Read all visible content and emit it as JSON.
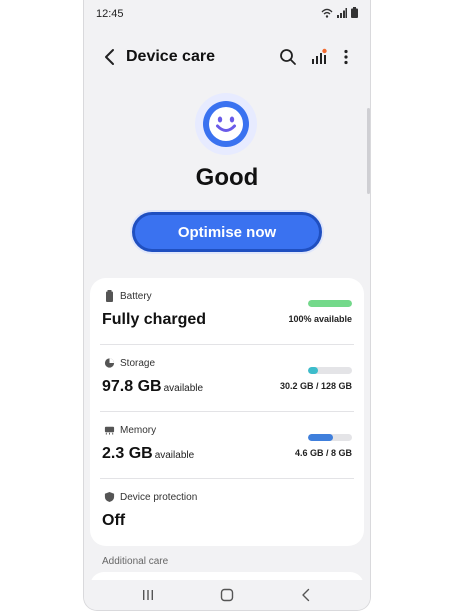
{
  "status_bar": {
    "time": "12:45"
  },
  "app_bar": {
    "title": "Device care",
    "icons": [
      "chevron-left-icon",
      "search-icon",
      "signal-report-icon",
      "more-vert-icon"
    ]
  },
  "hero": {
    "status": "Good",
    "face_icon": "smiley-face-icon",
    "button": "Optimise now"
  },
  "items": [
    {
      "label": "Battery",
      "value": "Fully charged",
      "unit": "",
      "meta": "100% available",
      "fraction": 1.0,
      "color": "#73d98a",
      "icon": "battery-icon"
    },
    {
      "label": "Storage",
      "value": "97.8 GB",
      "unit": "available",
      "meta": "30.2 GB / 128 GB",
      "fraction": 0.236,
      "color": "#3dbccb",
      "icon": "storage-pie-icon"
    },
    {
      "label": "Memory",
      "value": "2.3 GB",
      "unit": "available",
      "meta": "4.6 GB / 8 GB",
      "fraction": 0.575,
      "color": "#3f7fdc",
      "icon": "memory-chip-icon"
    },
    {
      "label": "Device protection",
      "value": "Off",
      "unit": "",
      "meta": "",
      "fraction": null,
      "color": "",
      "icon": "shield-icon"
    }
  ],
  "additional_care": "Additional care",
  "colors": {
    "accent": "#3a72f0",
    "background": "#f2f2f4",
    "alert_dot": "#f26a2e"
  }
}
